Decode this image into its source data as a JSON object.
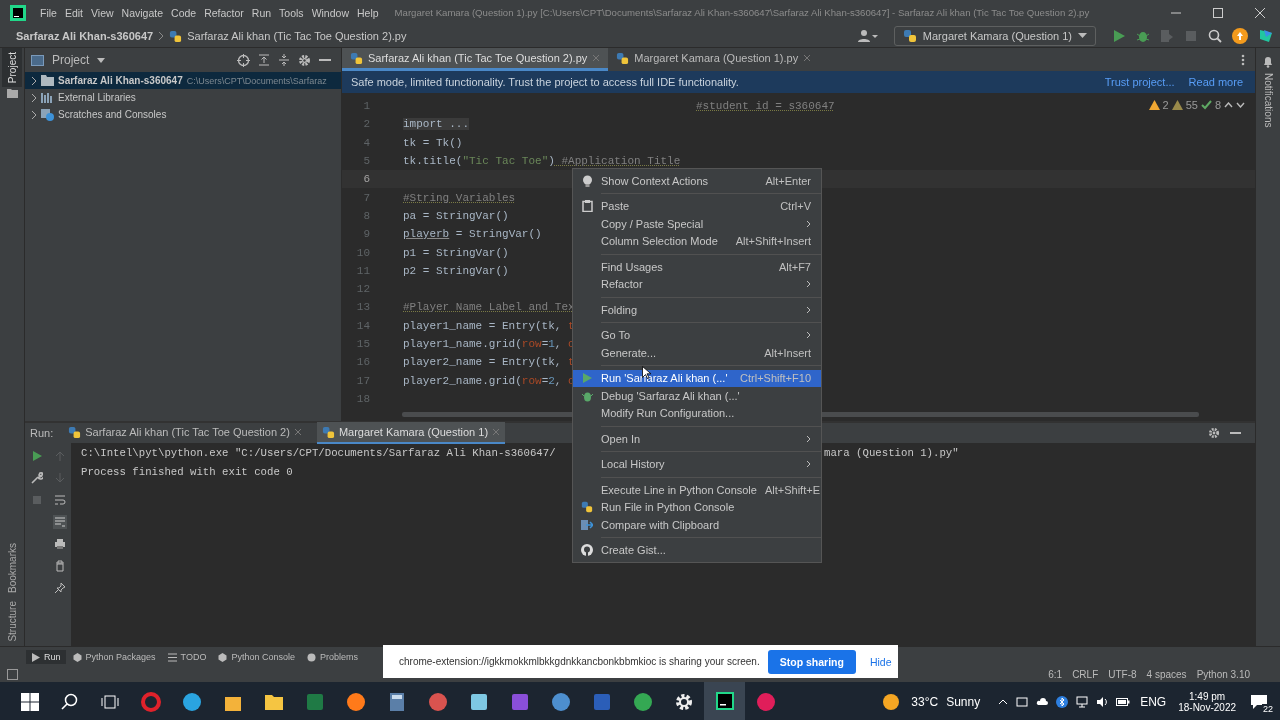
{
  "window": {
    "title": "Margaret Kamara (Question 1).py [C:\\Users\\CPT\\Documents\\Sarfaraz Ali Khan-s360647\\Sarfaraz Ali Khan-s360647] - Sarfaraz Ali khan  (Tic Tac Toe Question 2).py"
  },
  "menu_bar": [
    "File",
    "Edit",
    "View",
    "Navigate",
    "Code",
    "Refactor",
    "Run",
    "Tools",
    "Window",
    "Help"
  ],
  "breadcrumbs": [
    "Sarfaraz Ali Khan-s360647",
    "Sarfaraz Ali khan  (Tic Tac Toe Question 2).py"
  ],
  "run_config": "Margaret Kamara (Question 1)",
  "toolbar": [
    {
      "kind": "run",
      "disabled": false
    },
    {
      "kind": "debug",
      "disabled": false
    },
    {
      "kind": "coverage",
      "disabled": true
    },
    {
      "kind": "stop",
      "disabled": true
    }
  ],
  "left_stripe": [
    {
      "label": "Project",
      "selected": true
    },
    {
      "label": "Bookmarks",
      "selected": false
    },
    {
      "label": "Structure",
      "selected": false
    }
  ],
  "right_stripe": "Notifications",
  "project": {
    "title": "Project",
    "tree": [
      {
        "label": "Sarfaraz Ali Khan-s360647",
        "path": "C:\\Users\\CPT\\Documents\\Sarfaraz",
        "kind": "folder",
        "expanded": false,
        "selected": true
      },
      {
        "label": "External Libraries",
        "kind": "library",
        "expanded": false,
        "selected": false
      },
      {
        "label": "Scratches and Consoles",
        "kind": "scratch",
        "expanded": false,
        "selected": false
      }
    ]
  },
  "editor": {
    "tabs": [
      {
        "label": "Sarfaraz Ali khan  (Tic Tac Toe Question 2).py",
        "selected": true
      },
      {
        "label": "Margaret Kamara (Question 1).py",
        "selected": false
      }
    ],
    "banner": {
      "text": "Safe mode, limited functionality. Trust the project to access full IDE functionality.",
      "links": [
        "Trust project...",
        "Read more"
      ]
    },
    "inspections": {
      "errors": "2",
      "warnings": "55",
      "typos": "8"
    },
    "lines": [
      {
        "number": "1",
        "current": false,
        "tokens": [
          {
            "text": "#student id = s360647",
            "kind": "doc"
          }
        ]
      },
      {
        "number": "2",
        "current": false,
        "tokens": [
          {
            "text": "import ...",
            "kind": "folded"
          }
        ]
      },
      {
        "number": "4",
        "current": false,
        "tokens": [
          {
            "text": "tk = Tk()",
            "kind": "plain"
          }
        ]
      },
      {
        "number": "5",
        "current": false,
        "tokens": [
          {
            "text": "tk.title(",
            "kind": "plain"
          },
          {
            "text": "\"Tic Tac Toe\"",
            "kind": "string"
          },
          {
            "text": ")",
            "kind": "plain"
          },
          {
            "text": " #Application Title",
            "kind": "comment"
          }
        ]
      },
      {
        "number": "6",
        "current": true
      },
      {
        "number": "7",
        "current": false,
        "tokens": [
          {
            "text": "#String Variables",
            "kind": "comment"
          }
        ]
      },
      {
        "number": "8",
        "current": false,
        "tokens": [
          {
            "text": "pa = StringVar()",
            "kind": "plain"
          }
        ]
      },
      {
        "number": "9",
        "current": false,
        "tokens": [
          {
            "text": "playerb",
            "kind": "warn"
          },
          {
            "text": " = StringVar()",
            "kind": "plain"
          }
        ]
      },
      {
        "number": "10",
        "current": false,
        "tokens": [
          {
            "text": "p1 = StringVar()",
            "kind": "plain"
          }
        ]
      },
      {
        "number": "11",
        "current": false,
        "tokens": [
          {
            "text": "p2 = StringVar()",
            "kind": "plain"
          }
        ]
      },
      {
        "number": "12",
        "current": false
      },
      {
        "number": "13",
        "current": false,
        "tokens": [
          {
            "text": "#Player Name Label and Tex",
            "kind": "comment"
          }
        ]
      },
      {
        "number": "14",
        "current": false,
        "tokens": [
          {
            "text": "player1_name = Entry(tk, ",
            "kind": "plain"
          },
          {
            "text": "t",
            "kind": "param"
          }
        ]
      },
      {
        "number": "15",
        "current": false,
        "tokens": [
          {
            "text": "player1_name.grid(",
            "kind": "plain"
          },
          {
            "text": "row",
            "kind": "param"
          },
          {
            "text": "=",
            "kind": "plain"
          },
          {
            "text": "1",
            "kind": "number"
          },
          {
            "text": ", ",
            "kind": "plain"
          },
          {
            "text": "c",
            "kind": "param"
          }
        ]
      },
      {
        "number": "16",
        "current": false,
        "tokens": [
          {
            "text": "player2_name = Entry(tk, ",
            "kind": "plain"
          },
          {
            "text": "t",
            "kind": "param"
          }
        ]
      },
      {
        "number": "17",
        "current": false,
        "tokens": [
          {
            "text": "player2_name.grid(",
            "kind": "plain"
          },
          {
            "text": "row",
            "kind": "param"
          },
          {
            "text": "=",
            "kind": "plain"
          },
          {
            "text": "2",
            "kind": "number"
          },
          {
            "text": ", ",
            "kind": "plain"
          },
          {
            "text": "c",
            "kind": "param"
          }
        ]
      },
      {
        "number": "18",
        "current": false
      }
    ]
  },
  "context_menu": {
    "groups": [
      [
        {
          "label": "Show Context Actions",
          "shortcut": "Alt+Enter",
          "submenu": false,
          "selected": false
        }
      ],
      [
        {
          "label": "Paste",
          "shortcut": "Ctrl+V",
          "submenu": false,
          "selected": false
        },
        {
          "label": "Copy / Paste Special",
          "submenu": true,
          "selected": false
        },
        {
          "label": "Column Selection Mode",
          "shortcut": "Alt+Shift+Insert",
          "submenu": false,
          "selected": false
        }
      ],
      [
        {
          "label": "Find Usages",
          "shortcut": "Alt+F7",
          "submenu": false,
          "selected": false
        },
        {
          "label": "Refactor",
          "submenu": true,
          "selected": false
        }
      ],
      [
        {
          "label": "Folding",
          "submenu": true,
          "selected": false
        }
      ],
      [
        {
          "label": "Go To",
          "submenu": true,
          "selected": false
        },
        {
          "label": "Generate...",
          "shortcut": "Alt+Insert",
          "submenu": false,
          "selected": false
        }
      ],
      [
        {
          "label": "Run 'Sarfaraz Ali khan  (...'",
          "shortcut": "Ctrl+Shift+F10",
          "submenu": false,
          "selected": true
        },
        {
          "label": "Debug 'Sarfaraz Ali khan  (...'",
          "submenu": false,
          "selected": false
        },
        {
          "label": "Modify Run Configuration...",
          "submenu": false,
          "selected": false
        }
      ],
      [
        {
          "label": "Open In",
          "submenu": true,
          "selected": false
        }
      ],
      [
        {
          "label": "Local History",
          "submenu": true,
          "selected": false
        }
      ],
      [
        {
          "label": "Execute Line in Python Console",
          "shortcut": "Alt+Shift+E",
          "submenu": false,
          "selected": false
        },
        {
          "label": "Run File in Python Console",
          "submenu": false,
          "selected": false
        },
        {
          "label": "Compare with Clipboard",
          "submenu": false,
          "selected": false
        }
      ],
      [
        {
          "label": "Create Gist...",
          "submenu": false,
          "selected": false
        }
      ]
    ]
  },
  "run_panel": {
    "label": "Run:",
    "tabs": [
      {
        "label": "Sarfaraz Ali khan  (Tic Tac Toe Question 2)",
        "selected": false
      },
      {
        "label": "Margaret Kamara (Question 1)",
        "selected": true
      }
    ],
    "output": [
      [
        "C:\\Intel\\pyt\\python.exe \"C:/Users/CPT/Documents/Sarfaraz Ali Khan-s360647/",
        "mara (Question 1).py\""
      ],
      [
        "Process finished with exit code 0"
      ]
    ]
  },
  "tool_windows": [
    {
      "label": "Run",
      "selected": true
    },
    {
      "label": "Python Packages",
      "selected": false
    },
    {
      "label": "TODO",
      "selected": false
    },
    {
      "label": "Python Console",
      "selected": false
    },
    {
      "label": "Problems",
      "selected": false
    }
  ],
  "status_bar": [
    "6:1",
    "CRLF",
    "UTF-8",
    "4 spaces",
    "Python 3.10"
  ],
  "share_bar": {
    "text": "chrome-extension://igkkmokkmlbkkgdnkkancbonkbbmkioc is sharing your screen.",
    "stop": "Stop sharing",
    "hide": "Hide"
  },
  "taskbar": {
    "apps": [
      {
        "selected": false
      },
      {
        "selected": false
      },
      {
        "selected": false
      },
      {
        "selected": false
      },
      {
        "selected": false
      },
      {
        "selected": false
      },
      {
        "selected": false
      },
      {
        "selected": false
      },
      {
        "selected": false
      },
      {
        "selected": false
      },
      {
        "selected": false
      },
      {
        "selected": false
      },
      {
        "selected": false
      },
      {
        "selected": false
      },
      {
        "selected": true
      },
      {
        "selected": false
      }
    ],
    "weather": {
      "temperature": "33°C",
      "condition": "Sunny"
    },
    "language": "ENG",
    "time": "1:49 pm",
    "date": "18-Nov-2022",
    "notifications": "22"
  }
}
